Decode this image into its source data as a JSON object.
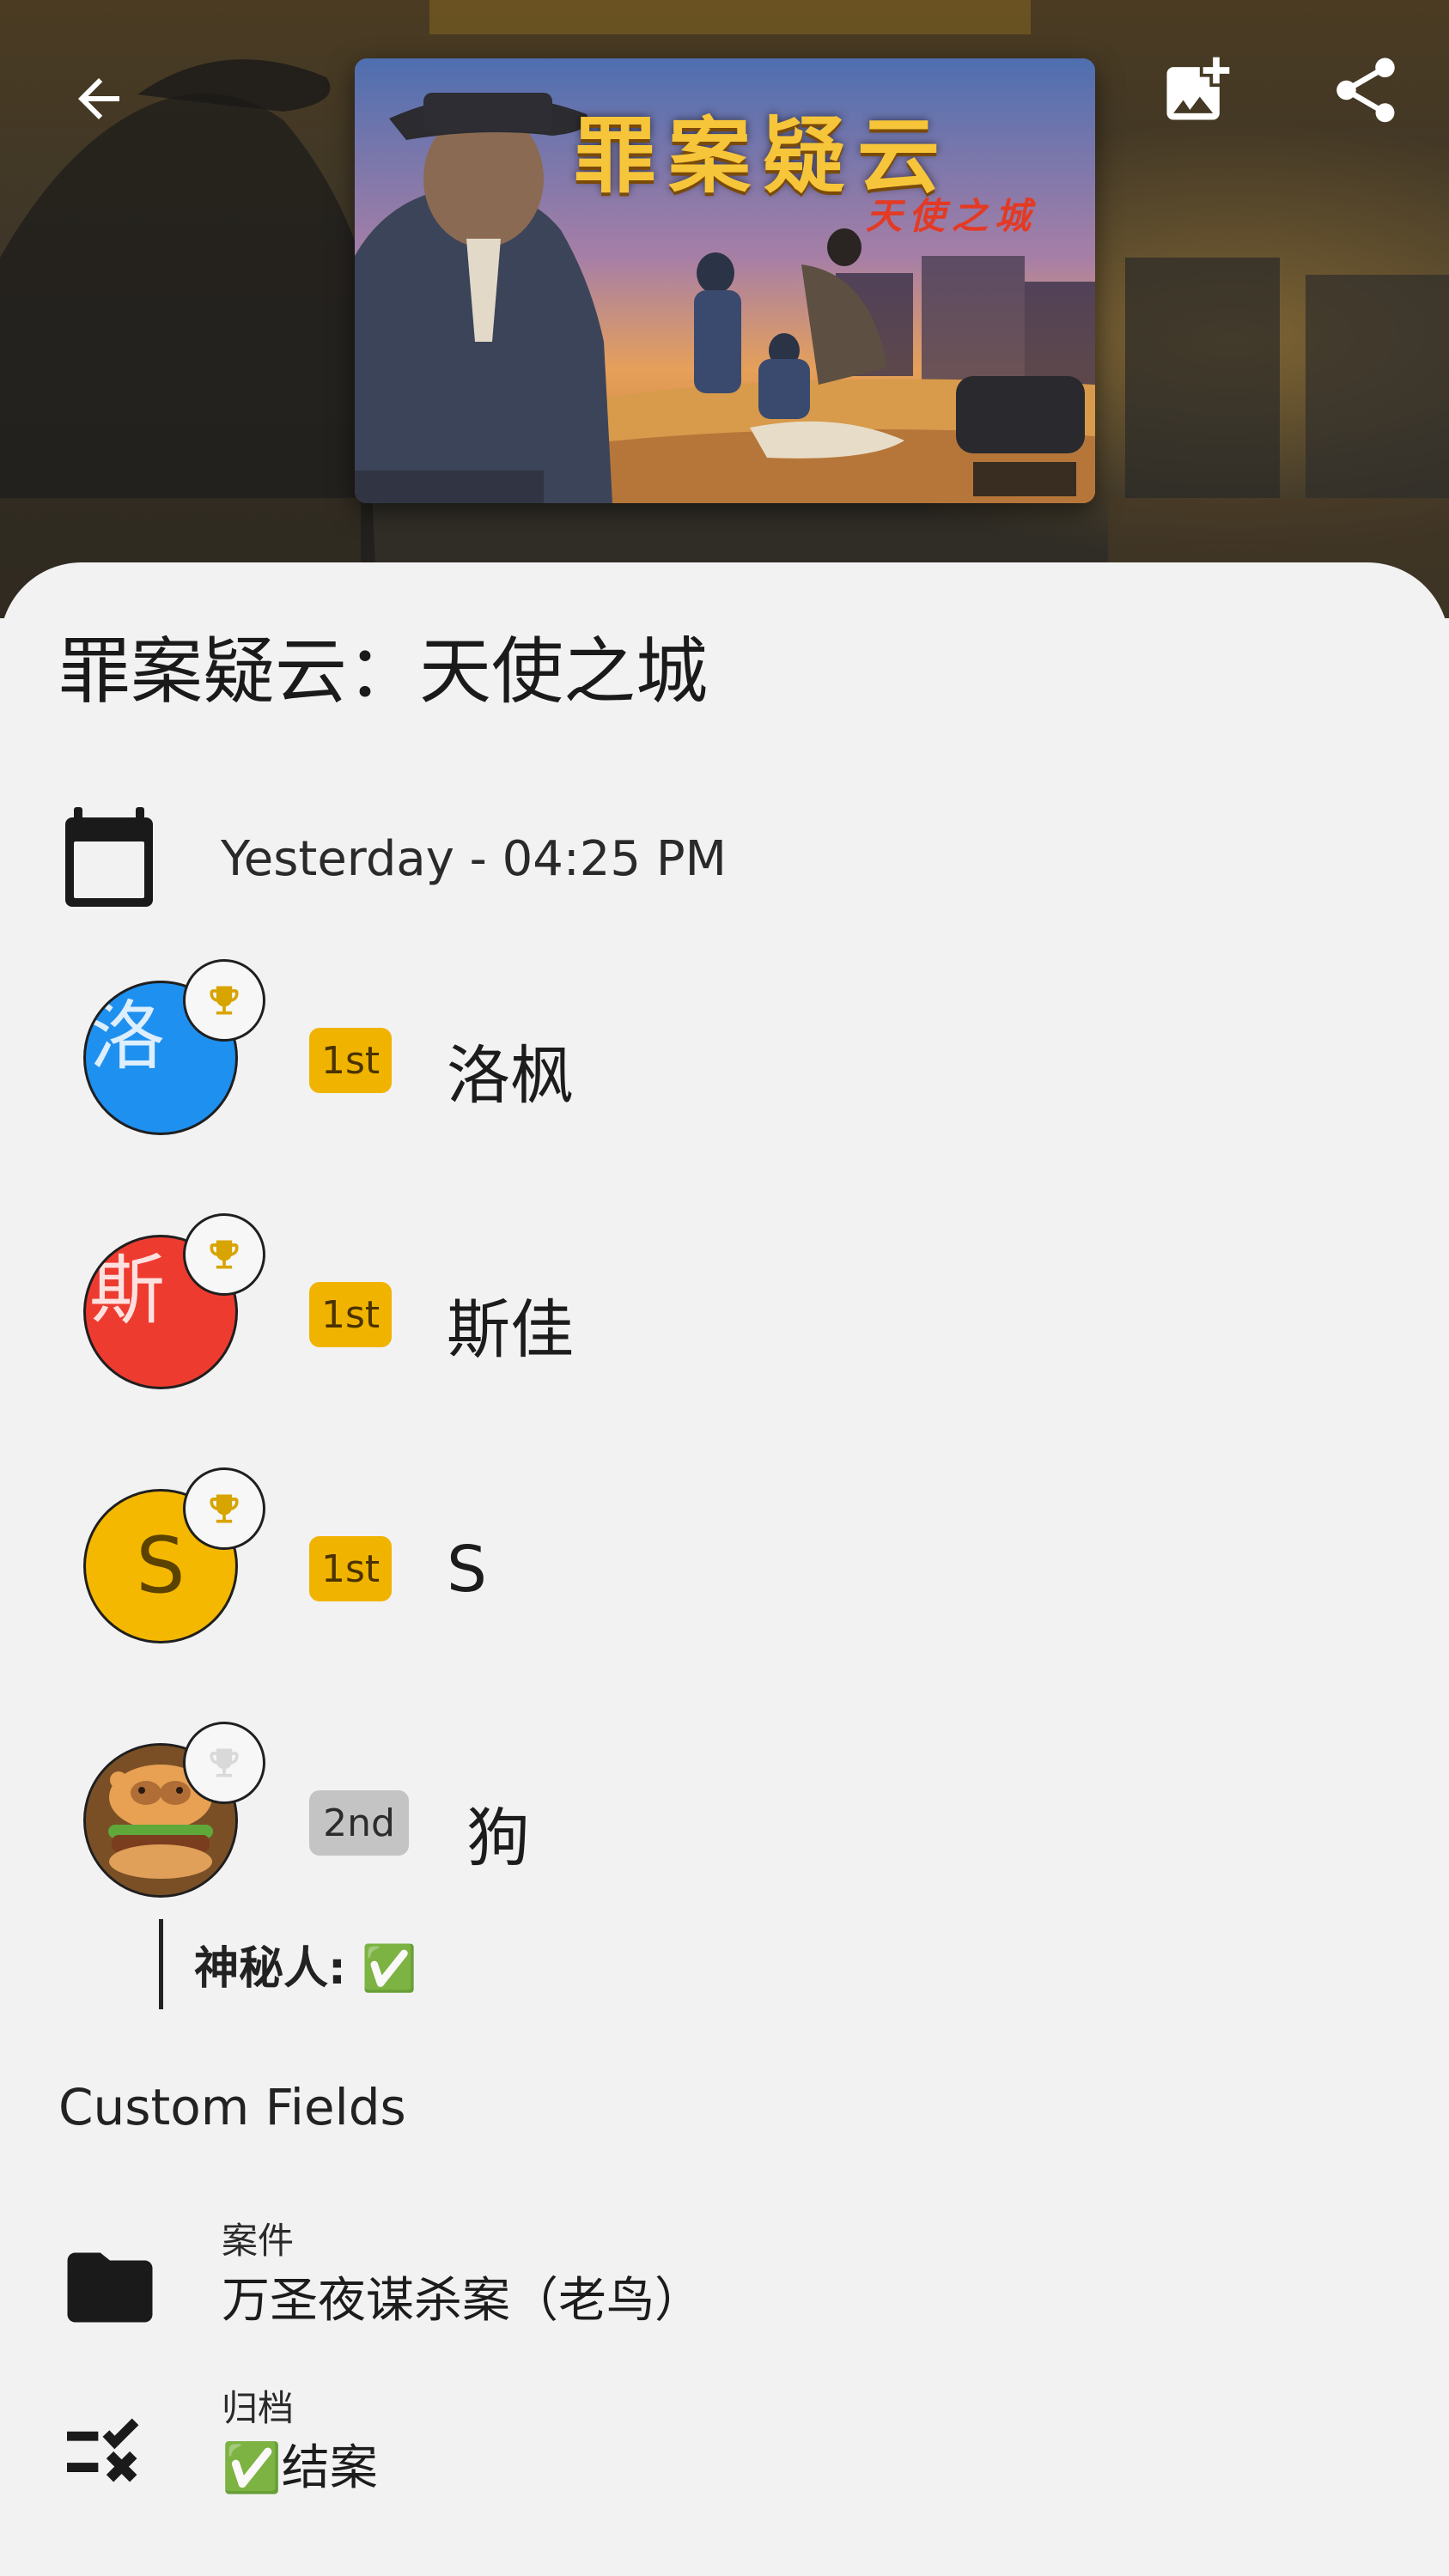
{
  "header": {
    "back_icon": "arrow-left-icon",
    "add_image_icon": "add-photo-icon",
    "share_icon": "share-icon",
    "cover": {
      "title": "罪案疑云",
      "subtitle": "天使之城"
    }
  },
  "game": {
    "title": "罪案疑云：天使之城",
    "date_icon": "calendar-icon",
    "date": "Yesterday - 04:25 PM"
  },
  "players": [
    {
      "initial": "洛",
      "avatar_color": "#1e90f0",
      "rank": "1st",
      "name": "洛枫",
      "winner": true
    },
    {
      "initial": "斯",
      "avatar_color": "#ee3b30",
      "rank": "1st",
      "name": "斯佳",
      "winner": true
    },
    {
      "initial": "S",
      "avatar_color": "#f5b800",
      "rank": "1st",
      "name": "S",
      "winner": true
    },
    {
      "initial": "",
      "avatar_color": "#c98d48",
      "rank": "2nd",
      "name": "狗",
      "winner": false
    }
  ],
  "player_note": "神秘人: ✅",
  "custom_fields": {
    "title": "Custom Fields",
    "items": [
      {
        "icon": "folder-icon",
        "label": "案件",
        "value": "万圣夜谋杀案（老鸟）"
      },
      {
        "icon": "checklist-icon",
        "label": "归档",
        "value": "✅结案"
      }
    ]
  },
  "colors": {
    "gold": "#f0b400",
    "silver": "#c4c4c4",
    "background": "#f2f2f2"
  }
}
